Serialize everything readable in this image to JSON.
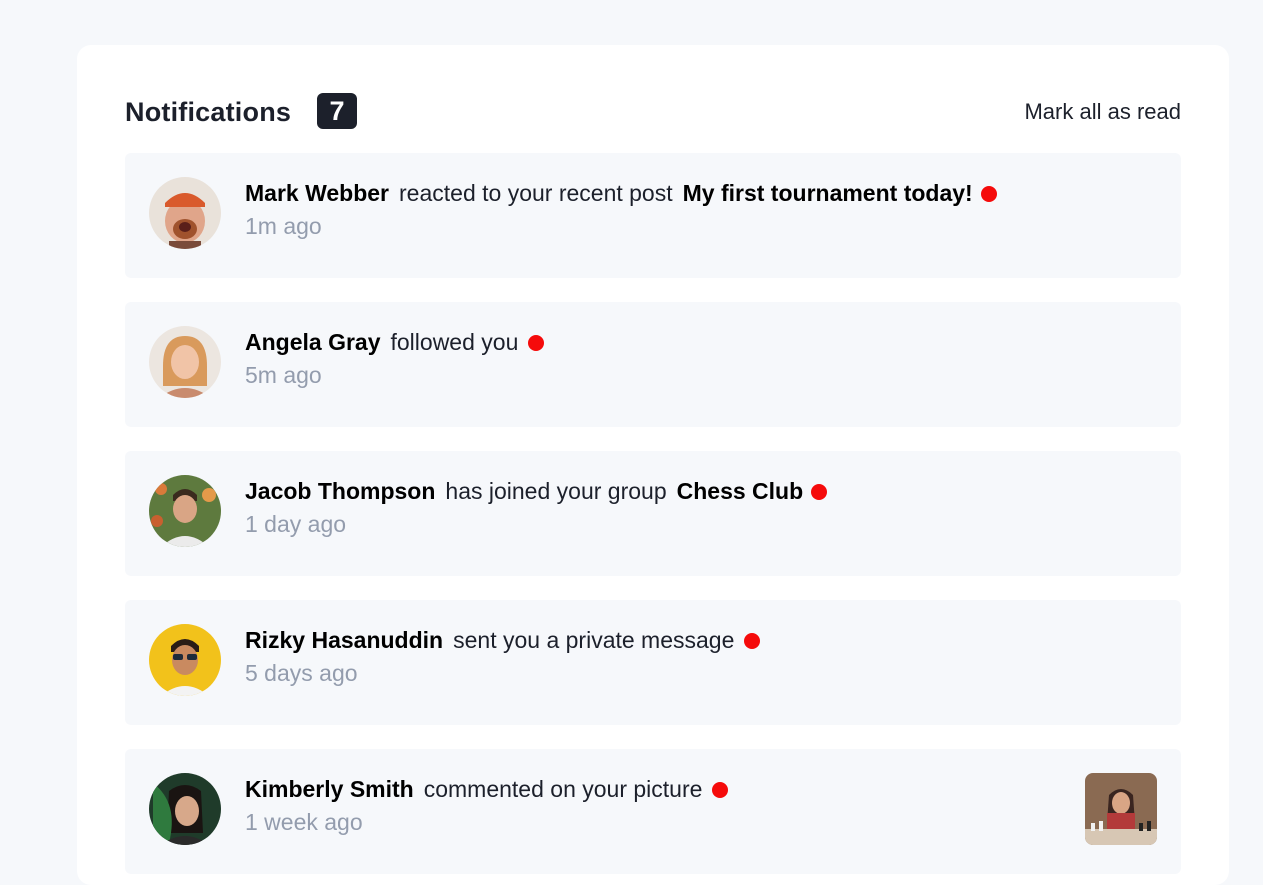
{
  "header": {
    "title": "Notifications",
    "count": "7",
    "mark_all_label": "Mark all as read"
  },
  "notifications": [
    {
      "name": "Mark Webber",
      "action": "reacted to your recent post",
      "target": "My first tournament today!",
      "time": "1m ago",
      "unread": true,
      "avatar": "avatar-mark-webber"
    },
    {
      "name": "Angela Gray",
      "action": "followed you",
      "target": "",
      "time": "5m ago",
      "unread": true,
      "avatar": "avatar-angela-gray"
    },
    {
      "name": "Jacob Thompson",
      "action": "has joined your group",
      "target": "Chess Club",
      "time": "1 day ago",
      "unread": true,
      "avatar": "avatar-jacob-thompson"
    },
    {
      "name": "Rizky Hasanuddin",
      "action": "sent you a private message",
      "target": "",
      "time": "5 days ago",
      "unread": true,
      "avatar": "avatar-rizky-hasanuddin"
    },
    {
      "name": "Kimberly Smith",
      "action": "commented on your picture",
      "target": "",
      "time": "1 week ago",
      "unread": true,
      "avatar": "avatar-kimberly-smith",
      "thumbnail": "chess-picture-thumbnail"
    }
  ],
  "colors": {
    "page_bg": "#f6f8fb",
    "card_bg": "#ffffff",
    "unread_dot": "#f50b0b",
    "badge_bg": "#1c202b",
    "muted_text": "#939cad"
  }
}
